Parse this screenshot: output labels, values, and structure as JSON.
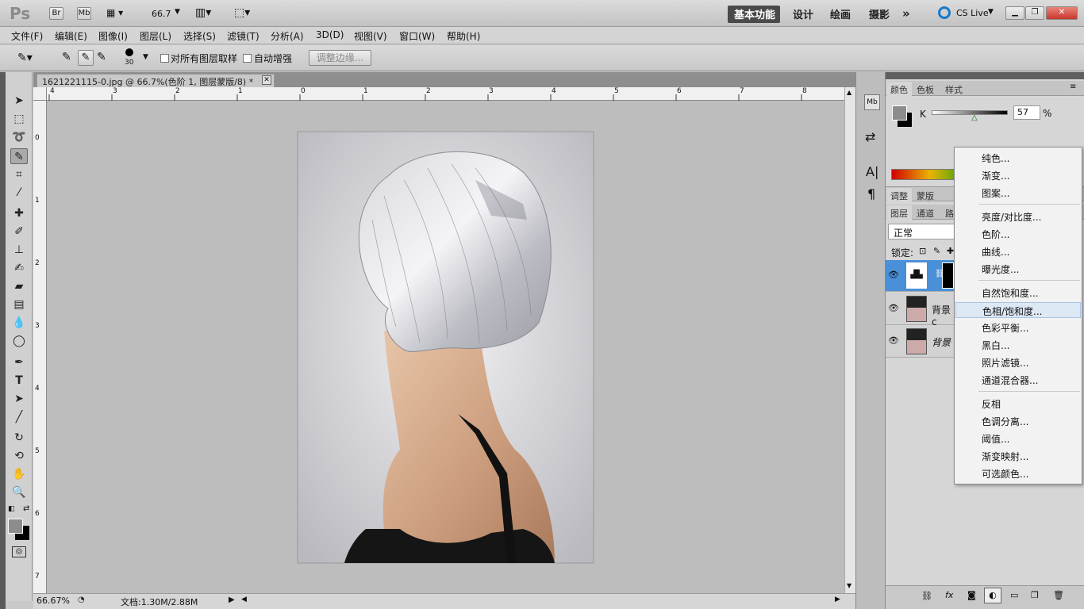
{
  "app": {
    "logo": "Ps",
    "bridge_button": "Br",
    "minibridge_button": "Mb",
    "zoom_value": "66.7",
    "workspaces": [
      "基本功能",
      "设计",
      "绘画",
      "摄影"
    ],
    "more_workspaces": "»",
    "cslive": "CS Live"
  },
  "menu": [
    "文件(F)",
    "编辑(E)",
    "图像(I)",
    "图层(L)",
    "选择(S)",
    "滤镜(T)",
    "分析(A)",
    "3D(D)",
    "视图(V)",
    "窗口(W)",
    "帮助(H)"
  ],
  "options": {
    "brush_size": "30",
    "sample_all_layers": "对所有图层取样",
    "auto_enhance": "自动增强",
    "refine_edge": "调整边缘..."
  },
  "document": {
    "tab_title": "1621221115-0.jpg @ 66.7%(色阶 1, 图层蒙版/8) *",
    "close": "✕",
    "ruler_top": [
      "4",
      "3",
      "2",
      "1",
      "0",
      "1",
      "2",
      "3",
      "4",
      "5",
      "6",
      "7",
      "8"
    ],
    "ruler_left": [
      "0",
      "1",
      "2",
      "3",
      "4",
      "5",
      "6",
      "7"
    ]
  },
  "status": {
    "zoom": "66.67%",
    "doc_info": "文档:1.30M/2.88M"
  },
  "panels": {
    "color_tabs": [
      "颜色",
      "色板",
      "样式"
    ],
    "color_channel": "K",
    "color_value": "57",
    "color_unit": "%",
    "adjust_tabs": [
      "调整",
      "蒙版"
    ],
    "layer_tabs": [
      "图层",
      "通道",
      "路"
    ],
    "blend_mode": "正常",
    "lock_label": "锁定:",
    "layers": [
      {
        "name": ""
      },
      {
        "name": "背景 c"
      },
      {
        "name": "背景"
      }
    ]
  },
  "adjustment_menu": {
    "group1": [
      "纯色...",
      "渐变...",
      "图案..."
    ],
    "group2": [
      "亮度/对比度...",
      "色阶...",
      "曲线...",
      "曝光度..."
    ],
    "group3": [
      "自然饱和度...",
      "色相/饱和度...",
      "色彩平衡...",
      "黑白...",
      "照片滤镜...",
      "通道混合器..."
    ],
    "group4": [
      "反相",
      "色调分离...",
      "阈值...",
      "渐变映射...",
      "可选颜色..."
    ],
    "highlighted": "色相/饱和度..."
  },
  "colors": {
    "workspace_active_bg": "#4a4a4a",
    "cslive_blue": "#1a7ac9",
    "close_red": "#d9443a",
    "menu_highlight": "#dde8f5"
  }
}
